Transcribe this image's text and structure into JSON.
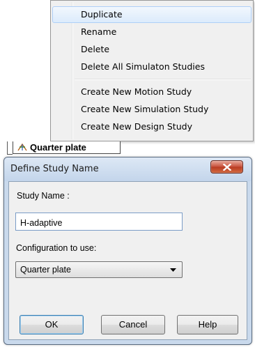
{
  "context_menu": {
    "items": [
      {
        "label": "Duplicate",
        "highlighted": true
      },
      {
        "label": "Rename"
      },
      {
        "label": "Delete"
      },
      {
        "label": "Delete All Simulaton Studies"
      },
      {
        "label": "Create New Motion Study"
      },
      {
        "label": "Create New Simulation Study"
      },
      {
        "label": "Create New Design Study"
      }
    ]
  },
  "tab": {
    "label": "Quarter plate",
    "icon": "part-icon"
  },
  "dialog": {
    "title": "Define Study Name",
    "close_icon": "close-icon",
    "study_name_label": "Study Name :",
    "study_name_value": "H-adaptive",
    "configuration_label": "Configuration to use:",
    "configuration_value": "Quarter plate",
    "buttons": {
      "ok": "OK",
      "cancel": "Cancel",
      "help": "Help"
    }
  },
  "colors": {
    "menu_hover": "#dcebfc",
    "title_bar": "#c9d9ec",
    "close_button": "#c7503a"
  }
}
